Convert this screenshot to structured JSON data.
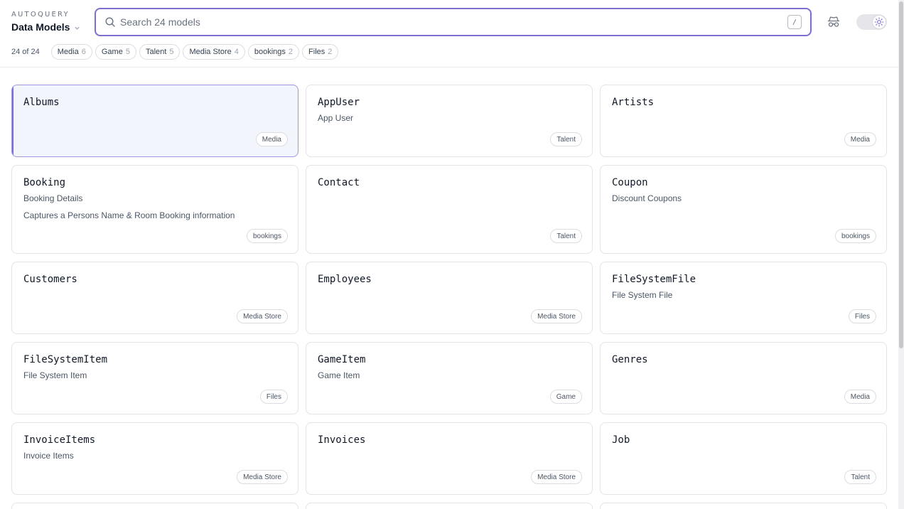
{
  "header": {
    "brand_small": "AUTOQUERY",
    "brand_title": "Data Models",
    "search_placeholder": "Search 24 models",
    "search_value": "",
    "shortcut_key": "/"
  },
  "filters": {
    "count_label": "24 of 24",
    "chips": [
      {
        "label": "Media",
        "count": "6"
      },
      {
        "label": "Game",
        "count": "5"
      },
      {
        "label": "Talent",
        "count": "5"
      },
      {
        "label": "Media Store",
        "count": "4"
      },
      {
        "label": "bookings",
        "count": "2"
      },
      {
        "label": "Files",
        "count": "2"
      }
    ]
  },
  "cards": [
    {
      "name": "Albums",
      "desc": "",
      "notes": "",
      "tag": "Media"
    },
    {
      "name": "AppUser",
      "desc": "App User",
      "notes": "",
      "tag": "Talent"
    },
    {
      "name": "Artists",
      "desc": "",
      "notes": "",
      "tag": "Media"
    },
    {
      "name": "Booking",
      "desc": "Booking Details",
      "notes": "Captures a Persons Name & Room Booking information",
      "tag": "bookings"
    },
    {
      "name": "Contact",
      "desc": "",
      "notes": "",
      "tag": "Talent"
    },
    {
      "name": "Coupon",
      "desc": "Discount Coupons",
      "notes": "",
      "tag": "bookings"
    },
    {
      "name": "Customers",
      "desc": "",
      "notes": "",
      "tag": "Media Store"
    },
    {
      "name": "Employees",
      "desc": "",
      "notes": "",
      "tag": "Media Store"
    },
    {
      "name": "FileSystemFile",
      "desc": "File System File",
      "notes": "",
      "tag": "Files"
    },
    {
      "name": "FileSystemItem",
      "desc": "File System Item",
      "notes": "",
      "tag": "Files"
    },
    {
      "name": "GameItem",
      "desc": "Game Item",
      "notes": "",
      "tag": "Game"
    },
    {
      "name": "Genres",
      "desc": "",
      "notes": "",
      "tag": "Media"
    },
    {
      "name": "InvoiceItems",
      "desc": "Invoice Items",
      "notes": "",
      "tag": "Media Store"
    },
    {
      "name": "Invoices",
      "desc": "",
      "notes": "",
      "tag": "Media Store"
    },
    {
      "name": "Job",
      "desc": "",
      "notes": "",
      "tag": "Talent"
    },
    {
      "name": "",
      "desc": "",
      "notes": "",
      "tag": ""
    },
    {
      "name": "",
      "desc": "",
      "notes": "",
      "tag": ""
    },
    {
      "name": "",
      "desc": "",
      "notes": "",
      "tag": ""
    }
  ],
  "colors": {
    "accent": "#7c6fd0",
    "selected_bg": "#f3f5fd"
  },
  "icons": {
    "search": "search-icon",
    "chevron": "chevron-down-icon",
    "incognito": "incognito-icon",
    "theme": "sun-icon"
  }
}
